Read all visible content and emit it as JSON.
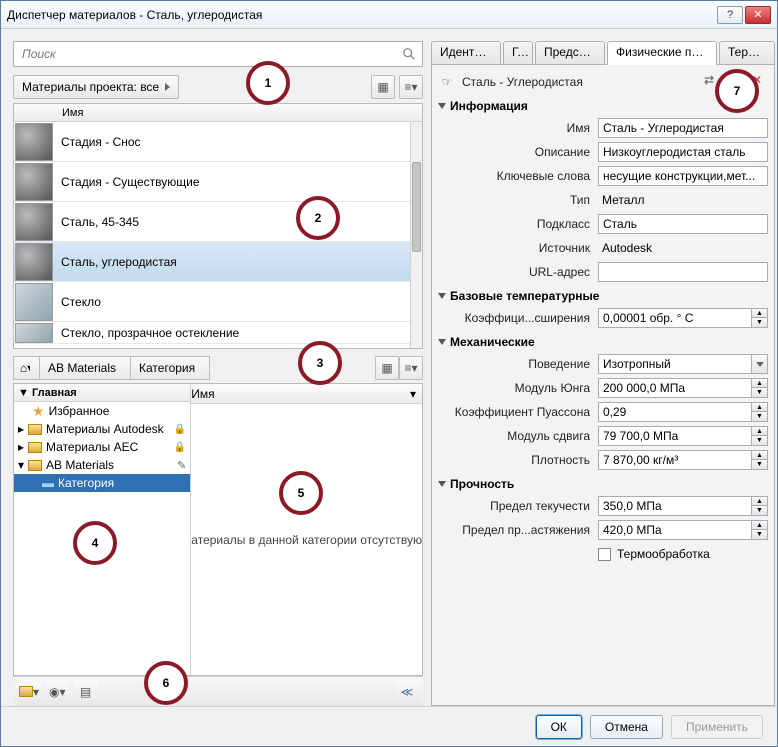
{
  "window": {
    "title": "Диспетчер материалов - Сталь, углеродистая"
  },
  "search": {
    "placeholder": "Поиск"
  },
  "project_filter": {
    "label": "Материалы проекта: все"
  },
  "list": {
    "header": "Имя",
    "items": [
      {
        "name": "Стадия - Снос"
      },
      {
        "name": "Стадия - Существующие"
      },
      {
        "name": "Сталь, 45-345"
      },
      {
        "name": "Сталь, углеродистая",
        "selected": true
      },
      {
        "name": "Стекло"
      },
      {
        "name": "Стекло, прозрачное остекление"
      }
    ]
  },
  "breadcrumb": {
    "home": "⌂",
    "lib": "AB Materials",
    "cat": "Категория"
  },
  "tree": {
    "header": "▼ Главная",
    "fav": "Избранное",
    "libs": [
      {
        "name": "Материалы Autodesk",
        "lock": true
      },
      {
        "name": "Материалы AEC",
        "lock": true
      },
      {
        "name": "AB Materials",
        "edit": true,
        "expanded": true
      }
    ],
    "cat": "Категория"
  },
  "catpane": {
    "header": "Имя",
    "msg": "атериалы в данной категории отсутствую"
  },
  "tabs": [
    "Идентиф...",
    "Г...",
    "Предста...",
    "Физические пара...",
    "Терма..."
  ],
  "active_tab": 3,
  "editor": {
    "title": "Сталь - Углеродистая",
    "info_hdr": "Информация",
    "info": {
      "name_l": "Имя",
      "name_v": "Сталь - Углеродистая",
      "desc_l": "Описание",
      "desc_v": "Низкоуглеродистая сталь",
      "kw_l": "Ключевые слова",
      "kw_v": "несущие конструкции,мет...",
      "type_l": "Тип",
      "type_v": "Металл",
      "sub_l": "Подкласс",
      "sub_v": "Сталь",
      "src_l": "Источник",
      "src_v": "Autodesk",
      "url_l": "URL-адрес",
      "url_v": ""
    },
    "therm_hdr": "Базовые температурные",
    "therm": {
      "coef_l": "Коэффици...сширения",
      "coef_v": "0,00001 обр. ° C"
    },
    "mech_hdr": "Механические",
    "mech": {
      "beh_l": "Поведение",
      "beh_v": "Изотропный",
      "ym_l": "Модуль Юнга",
      "ym_v": "200 000,0 МПа",
      "pr_l": "Коэффициент Пуассона",
      "pr_v": "0,29",
      "sm_l": "Модуль сдвига",
      "sm_v": "79 700,0 МПа",
      "den_l": "Плотность",
      "den_v": "7 870,00 кг/м³"
    },
    "str_hdr": "Прочность",
    "str": {
      "yi_l": "Предел текучести",
      "yi_v": "350,0 МПа",
      "te_l": "Предел пр...астяжения",
      "te_v": "420,0 МПа",
      "ht_l": "Термообработка"
    }
  },
  "footer": {
    "ok": "ОК",
    "cancel": "Отмена",
    "apply": "Применить"
  },
  "callouts": [
    "1",
    "2",
    "3",
    "4",
    "5",
    "6",
    "7"
  ]
}
